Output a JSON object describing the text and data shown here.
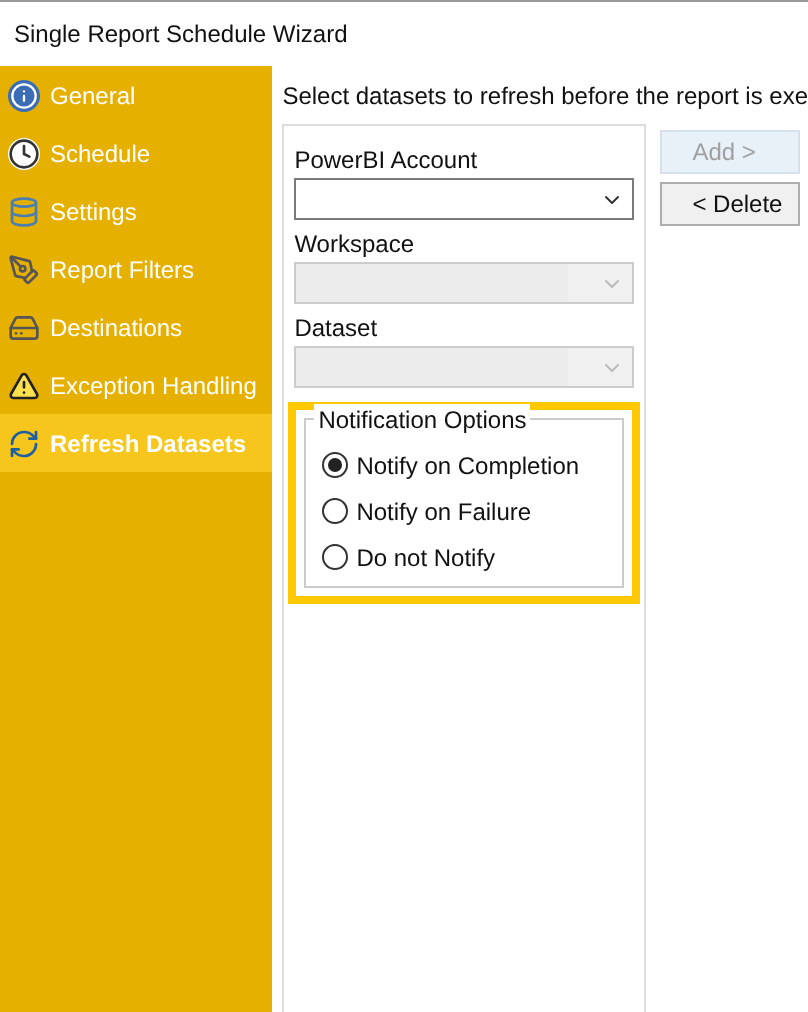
{
  "window": {
    "title": "Single Report Schedule Wizard"
  },
  "sidebar": {
    "items": [
      {
        "label": "General",
        "kind": "info",
        "selected": false
      },
      {
        "label": "Schedule",
        "kind": "clock",
        "selected": false
      },
      {
        "label": "Settings",
        "kind": "settings",
        "selected": false
      },
      {
        "label": "Report Filters",
        "kind": "filter",
        "selected": false
      },
      {
        "label": "Destinations",
        "kind": "drive",
        "selected": false
      },
      {
        "label": "Exception Handling",
        "kind": "warning",
        "selected": false
      },
      {
        "label": "Refresh Datasets",
        "kind": "refresh",
        "selected": true
      }
    ]
  },
  "instructions": "Select datasets to refresh before the report is exe",
  "fields": [
    {
      "label": "PowerBI Account",
      "disabled": false
    },
    {
      "label": "Workspace",
      "disabled": true
    },
    {
      "label": "Dataset",
      "disabled": true
    }
  ],
  "notification_options": {
    "title": "Notification Options",
    "options": [
      {
        "label": "Notify on Completion",
        "selected": true
      },
      {
        "label": "Notify on Failure",
        "selected": false
      },
      {
        "label": "Do not Notify",
        "selected": false
      }
    ]
  },
  "buttons": [
    {
      "label": "Add >",
      "disabled": true
    },
    {
      "label": "< Delete",
      "disabled": false
    }
  ]
}
